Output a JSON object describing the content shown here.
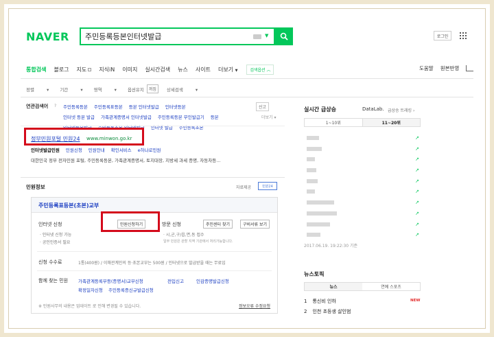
{
  "logo": "NAVER",
  "search": {
    "query": "주민등록등본인터넷발급"
  },
  "header": {
    "login": "로그인"
  },
  "tabs": [
    "통합검색",
    "블로그",
    "지도",
    "지식iN",
    "이미지",
    "실시간검색",
    "뉴스",
    "사이트",
    "더보기"
  ],
  "tabs_option": "검색옵션",
  "right_tabs": [
    "도움말",
    "원본반영"
  ],
  "filters": {
    "sort": "정렬",
    "period": "기간",
    "area": "영역",
    "adult_label": "옵션유지",
    "adult_value": "꺼짐",
    "detail": "상세검색"
  },
  "related": {
    "title": "연관검색어",
    "help": "?",
    "rows": [
      [
        "주민등록등본",
        "주민등록표등본",
        "등본 인터넷발급",
        "인터넷등본"
      ],
      [
        "인터넷 등본 발급",
        "가족관계증명서 인터넷발급",
        "주민등록등본 무인발급기",
        "등본"
      ],
      [
        "인터넷등본발급",
        "주민등록초본 인터넷발급",
        "인터넷 발급",
        "주민등록초본"
      ]
    ],
    "report": "신고",
    "more": "더보기"
  },
  "site": {
    "title": "정부민원포털 민원24",
    "url": "www.minwon.go.kr",
    "links": [
      "인터넷발급민원",
      "민원신청",
      "민원안내",
      "확인서비스",
      "e하나로민원"
    ],
    "desc": "대한민국 정부 전자민원 포털, 주민등록등본, 가족관계증명서, 토지대장, 지방세 과세 증명, 자동차등..."
  },
  "civil": {
    "title": "민원정보",
    "provider": "자료제공",
    "provider_logo": "민원24",
    "card_title": "주민등록표등본(초본)교부",
    "online_label": "인터넷 신청",
    "online_btn": "민원신청하기",
    "online_notes": [
      "· 인터넷 신청 가능",
      "· 공인인증서 필요"
    ],
    "visit_label": "방문 신청",
    "visit_btn1": "주민센터 찾기",
    "visit_btn2": "구비서류 보기",
    "visit_notes": [
      "· 시,군,구/읍,면,동 접수",
      "일부 민원은 관할 지역 기관에서 처리가능합니다."
    ],
    "fee_label": "신청 수수료",
    "fee_value": "1통(400원) / 이해관계인의 등·초본교부는 500원 / 인터넷으로 발급받을 때는 무료입",
    "related_label": "함께 찾는 민원",
    "related_links": [
      "가족관계등록부등(증명서)교부신청",
      "전입신고",
      "인감증명발급신청",
      "확정일자신청",
      "주민등록증신규발급신청"
    ],
    "footer_note": "※ 민원사무의 내용은 업데이트 로 인해 변경될 수 있습니다.",
    "footer_link": "정보오류 수정요청"
  },
  "realtime": {
    "title": "실시간 급상승",
    "datalab": "DataLab.",
    "trend": "급상승 트래킹",
    "tabs": [
      "1~10위",
      "11~20위"
    ],
    "time": "2017.06.19. 19:22:30 기준"
  },
  "news": {
    "title": "뉴스토픽",
    "tabs": [
      "뉴스",
      "연예 스포츠"
    ],
    "items": [
      {
        "rank": "1",
        "text": "통신비 인하",
        "badge": "NEW"
      },
      {
        "rank": "2",
        "text": "인천 초등생 살인범"
      }
    ]
  },
  "colors": {
    "brand": "#03c75a",
    "link": "#1a3dc1",
    "highlight": "#d40a1b"
  }
}
